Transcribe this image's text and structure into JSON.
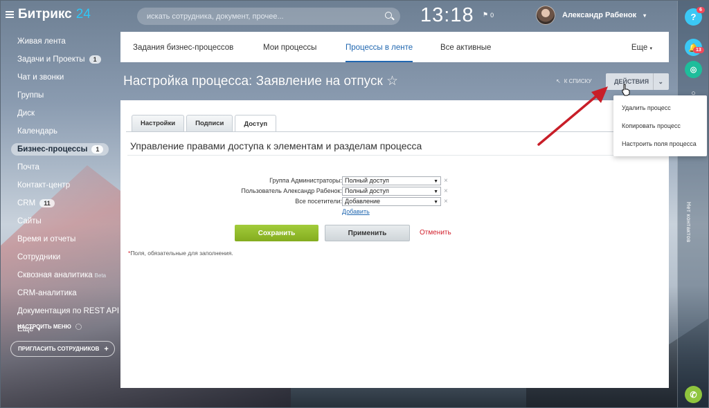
{
  "header": {
    "logo_text": "Битрикс",
    "logo_num": "24",
    "search_placeholder": "искать сотрудника, документ, прочее...",
    "clock": "13:18",
    "flag_count": "0",
    "user_name": "Александр Рабенок"
  },
  "sidebar": {
    "items": [
      {
        "label": "Живая лента",
        "count": ""
      },
      {
        "label": "Задачи и Проекты",
        "count": "1"
      },
      {
        "label": "Чат и звонки",
        "count": ""
      },
      {
        "label": "Группы",
        "count": ""
      },
      {
        "label": "Диск",
        "count": ""
      },
      {
        "label": "Календарь",
        "count": ""
      },
      {
        "label": "Бизнес-процессы",
        "count": "1"
      },
      {
        "label": "Почта",
        "count": ""
      },
      {
        "label": "Контакт-центр",
        "count": ""
      },
      {
        "label": "CRM",
        "count": "11"
      },
      {
        "label": "Сайты",
        "count": ""
      },
      {
        "label": "Время и отчеты",
        "count": ""
      },
      {
        "label": "Сотрудники",
        "count": ""
      },
      {
        "label": "Сквозная аналитика",
        "count": ""
      },
      {
        "label": "CRM-аналитика",
        "count": ""
      },
      {
        "label": "Документация по REST API",
        "count": ""
      },
      {
        "label": "Еще",
        "count": ""
      }
    ],
    "beta_label": "Beta",
    "settings_label": "НАСТРОИТЬ МЕНЮ",
    "invite_label": "ПРИГЛАСИТЬ СОТРУДНИКОВ"
  },
  "rightbar": {
    "help_badge": "6",
    "notif_badge": "13",
    "vertical_label": "Нет контактов"
  },
  "tabs": {
    "items": [
      "Задания бизнес-процессов",
      "Мои процессы",
      "Процессы в ленте",
      "Все активные"
    ],
    "active_index": 2,
    "more_label": "Еще"
  },
  "page": {
    "title": "Настройка процесса: Заявление на отпуск ☆",
    "back_label": "К СПИСКУ",
    "actions_label": "ДЕЙСТВИЯ"
  },
  "actions_menu": {
    "items": [
      "Удалить процесс",
      "Копировать процесс",
      "Настроить поля процесса"
    ]
  },
  "form": {
    "tabs": [
      "Настройки",
      "Подписи",
      "Доступ"
    ],
    "active_tab": "Доступ",
    "section_title": "Управление правами доступа к элементам и разделам процесса",
    "permissions": [
      {
        "label": "Группа Администраторы:",
        "value": "Полный доступ"
      },
      {
        "label": "Пользователь Александр Рабенок:",
        "value": "Полный доступ"
      },
      {
        "label": "Все посетители:",
        "value": "Добавление"
      }
    ],
    "add_label": "Добавить",
    "save_label": "Сохранить",
    "apply_label": "Применить",
    "cancel_label": "Отменить",
    "required_note": "Поля, обязательные для заполнения."
  },
  "colors": {
    "accent": "#2067b0",
    "save_green": "#96c12e",
    "danger": "#d2202c",
    "annotation_arrow": "#d0202a"
  }
}
